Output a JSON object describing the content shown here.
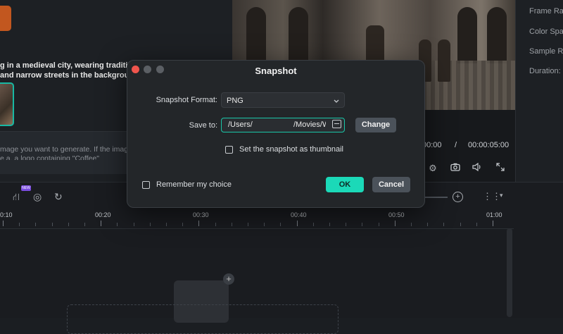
{
  "background": {
    "prompt_lines": [
      "g in a medieval city, wearing traditio",
      "and narrow streets in the backgroun"
    ],
    "input_lines": [
      "mage you want to generate. If the image",
      "e.a. a logo containing \"Coffee\""
    ],
    "playback": {
      "current_time": "00:00",
      "separator": "/",
      "total_time": "00:00:05:00"
    },
    "properties": [
      "Frame Rate",
      "Color Space",
      "Sample Rate",
      "Duration:"
    ],
    "timeline": {
      "new_badge": "NEW",
      "ruler_labels": [
        "0:10",
        "00:20",
        "00:30",
        "00:40",
        "00:50",
        "01:00"
      ]
    }
  },
  "dialog": {
    "title": "Snapshot",
    "format_label": "Snapshot Format:",
    "format_value": "PNG",
    "save_to_label": "Save to:",
    "path_start": "/Users/",
    "path_end": "/Movies/Wondershare",
    "change_label": "Change",
    "thumbnail_label": "Set the snapshot as thumbnail",
    "thumbnail_checked": false,
    "remember_label": "Remember my choice",
    "remember_checked": false,
    "ok_label": "OK",
    "cancel_label": "Cancel",
    "accent_color": "#1bd9b8",
    "close_color": "#f0554d"
  }
}
